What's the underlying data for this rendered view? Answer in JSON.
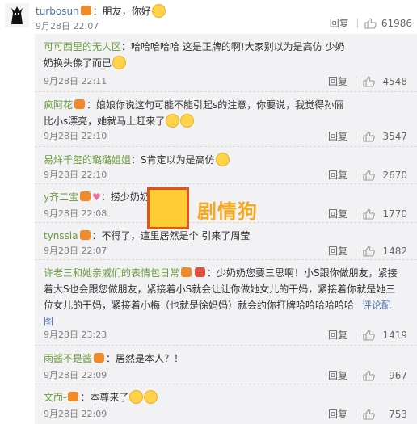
{
  "top_comment": {
    "username": "turbosun",
    "text": "：朋友，你好",
    "date": "9月28日 22:07",
    "reply_label": "回复",
    "likes": "61986"
  },
  "replies": [
    {
      "username": "可可西里的无人区",
      "text": "：哈哈哈哈哈 这是正牌的啊!大家别以为是高仿 少奶奶换头像了而已",
      "date": "9月28日 22:11",
      "reply_label": "回复",
      "likes": "4548"
    },
    {
      "username": "疯阿花",
      "text": "：娘娘你说这句可能不能引起s的注意，你要说，我觉得孙俪比小s漂亮，她就马上赶来了",
      "date": "9月28日 22:10",
      "reply_label": "回复",
      "likes": "3547"
    },
    {
      "username": "易烊千玺的璐璐姐姐",
      "text": "：S肯定以为是高仿",
      "date": "9月28日 22:10",
      "reply_label": "回复",
      "likes": "2670"
    },
    {
      "username": "y齐二宝",
      "text": "：捞少奶奶",
      "date": "9月28日 22:08",
      "reply_label": "回复",
      "likes": "1770"
    },
    {
      "username": "tynssia",
      "text": "：不得了，這里居然是个 引来了周莹",
      "date": "9月28日 22:07",
      "reply_label": "回复",
      "likes": "1482"
    },
    {
      "username": "许老三和她亲戚们的表情包日常",
      "text": "：少奶奶您要三思啊！小S跟你做朋友，紧接着大S也会跟您做朋友，紧接着小S就会让让你做她女儿的干妈，紧接着你就是她三位女儿的干妈，紧接着小梅（也就是徐妈妈）就会约你打牌哈哈哈哈哈哈",
      "comment_label": "评论配图",
      "date": "9月28日 23:23",
      "reply_label": "回复",
      "likes": "1419"
    },
    {
      "username": "雨酱不是酱",
      "text": "：居然是本人？！",
      "date": "9月28日 22:09",
      "reply_label": "回复",
      "likes": "967"
    },
    {
      "username": "文而-",
      "text": "：本尊来了",
      "date": "9月28日 22:09",
      "reply_label": "回复",
      "likes": "753"
    }
  ],
  "watermark": {
    "text": "剧情狗"
  },
  "colors": {
    "username_green": "#6a9a3b",
    "link_blue": "#4a72ad",
    "reply_bg": "#f2f2f5"
  }
}
